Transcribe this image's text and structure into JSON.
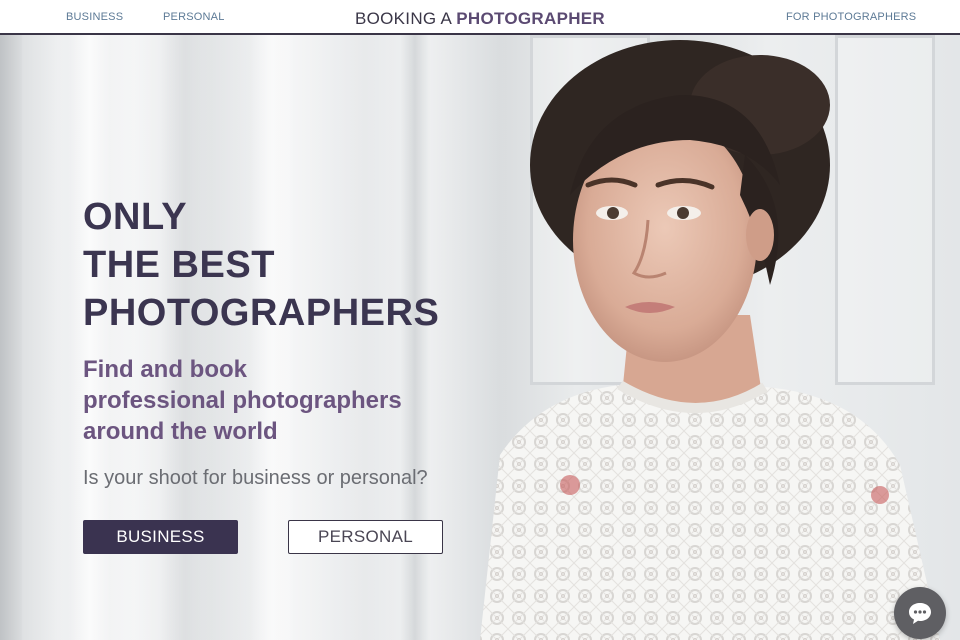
{
  "nav": {
    "business": "BUSINESS",
    "personal": "PERSONAL",
    "brand_prefix": "BOOKING A ",
    "brand_strong": "PHOTOGRAPHER",
    "for_photographers": "FOR PHOTOGRAPHERS"
  },
  "hero": {
    "headline": [
      "ONLY",
      "THE BEST",
      "PHOTOGRAPHERS"
    ],
    "subheadline": [
      "Find and book",
      "professional photographers",
      "around the world"
    ],
    "question": "Is your shoot for business or personal?",
    "business_button": "BUSINESS",
    "personal_button": "PERSONAL"
  },
  "icons": {
    "chat": "chat-bubble-icon"
  },
  "colors": {
    "primary": "#3a3350",
    "accent": "#6c5580",
    "nav_link": "#5d7a96"
  }
}
